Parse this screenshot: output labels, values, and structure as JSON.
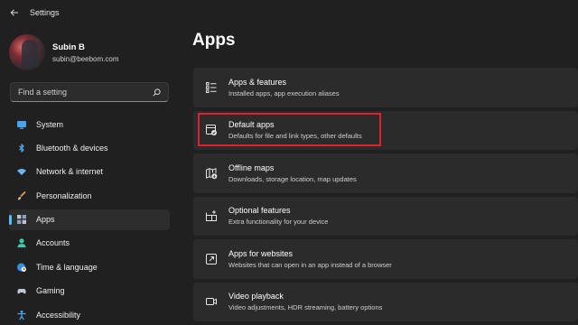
{
  "window": {
    "title": "Settings"
  },
  "profile": {
    "name": "Subin B",
    "email": "subin@beebom.com"
  },
  "search": {
    "placeholder": "Find a setting"
  },
  "nav": {
    "items": [
      {
        "label": "System",
        "icon": "monitor-icon"
      },
      {
        "label": "Bluetooth & devices",
        "icon": "bluetooth-icon"
      },
      {
        "label": "Network & internet",
        "icon": "wifi-icon"
      },
      {
        "label": "Personalization",
        "icon": "brush-icon"
      },
      {
        "label": "Apps",
        "icon": "apps-icon",
        "active": true
      },
      {
        "label": "Accounts",
        "icon": "person-icon"
      },
      {
        "label": "Time & language",
        "icon": "globe-clock-icon"
      },
      {
        "label": "Gaming",
        "icon": "gamepad-icon"
      },
      {
        "label": "Accessibility",
        "icon": "accessibility-icon"
      }
    ]
  },
  "main": {
    "title": "Apps",
    "cards": [
      {
        "title": "Apps & features",
        "subtitle": "Installed apps, app execution aliases",
        "icon": "list-icon"
      },
      {
        "title": "Default apps",
        "subtitle": "Defaults for file and link types, other defaults",
        "icon": "default-apps-icon",
        "highlighted": true
      },
      {
        "title": "Offline maps",
        "subtitle": "Downloads, storage location, map updates",
        "icon": "map-download-icon"
      },
      {
        "title": "Optional features",
        "subtitle": "Extra functionality for your device",
        "icon": "grid-plus-icon"
      },
      {
        "title": "Apps for websites",
        "subtitle": "Websites that can open in an app instead of a browser",
        "icon": "open-external-icon"
      },
      {
        "title": "Video playback",
        "subtitle": "Video adjustments, HDR streaming, battery options",
        "icon": "video-icon"
      }
    ]
  },
  "colors": {
    "accent": "#4cc2ff",
    "highlight": "#e0202a",
    "background": "#202020",
    "card": "#2b2b2b"
  }
}
